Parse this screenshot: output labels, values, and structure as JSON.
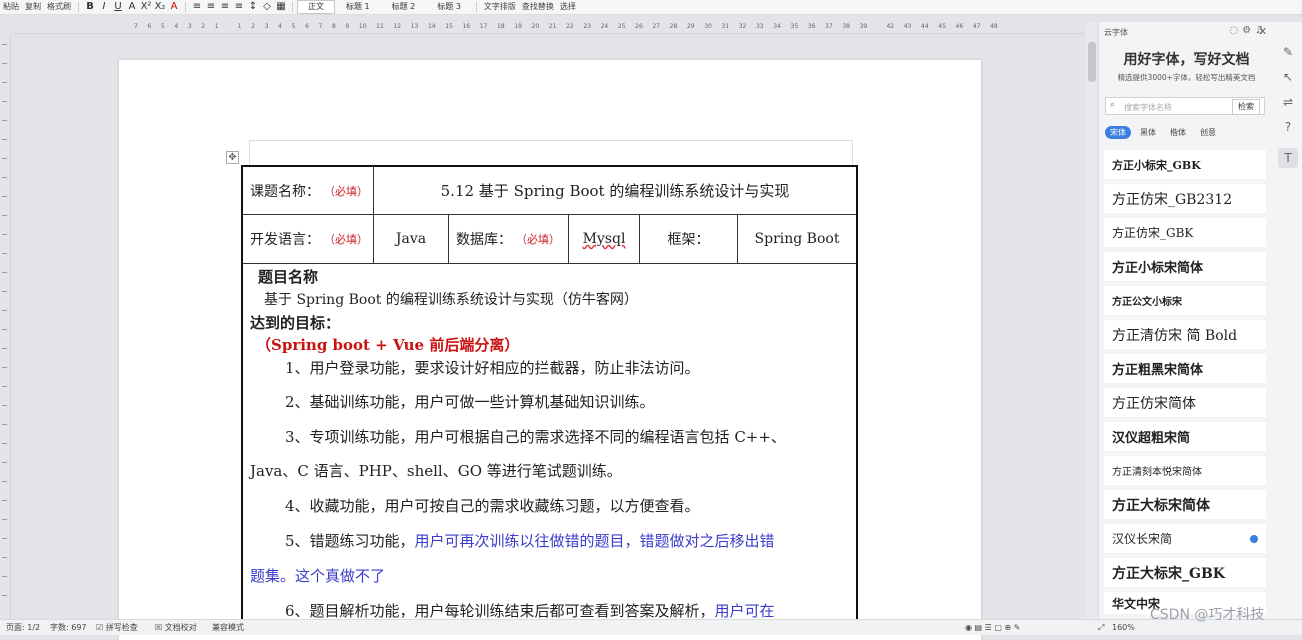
{
  "toolbar": {
    "items": [
      "粘贴",
      "复制",
      "格式刷"
    ],
    "format_buttons": [
      "B",
      "I",
      "U",
      "A",
      "X²",
      "X₂",
      "A"
    ],
    "styles": [
      "正文",
      "标题 1",
      "标题 2",
      "标题 3"
    ],
    "text_layout": "文字排版",
    "find_replace": "查找替换",
    "select": "选择"
  },
  "ruler": {
    "numbers": [
      "7",
      "6",
      "5",
      "4",
      "3",
      "2",
      "1",
      "",
      "1",
      "2",
      "3",
      "4",
      "5",
      "6",
      "7",
      "8",
      "9",
      "10",
      "11",
      "12",
      "13",
      "14",
      "15",
      "16",
      "17",
      "18",
      "19",
      "20",
      "21",
      "22",
      "23",
      "24",
      "25",
      "26",
      "27",
      "28",
      "29",
      "30",
      "31",
      "32",
      "33",
      "34",
      "35",
      "36",
      "37",
      "38",
      "39",
      "",
      "42",
      "43",
      "44",
      "45",
      "46",
      "47",
      "48"
    ]
  },
  "document": {
    "row1": {
      "label": "课题名称：",
      "required": "（必填）",
      "value": "5.12 基于 Spring Boot 的编程训练系统设计与实现"
    },
    "row2": {
      "lang_label": "开发语言：",
      "lang_required": "（必填）",
      "lang_value": "Java",
      "db_label": "数据库：",
      "db_required": "（必填）",
      "db_value": "Mysql",
      "fw_label": "框架：",
      "fw_value": "Spring Boot"
    },
    "heading": "题目名称",
    "title_line": "基于 Spring Boot 的编程训练系统设计与实现（仿牛客网）",
    "goal_label": "达到的目标：",
    "arch_note": "（Spring boot + Vue 前后端分离）",
    "items": [
      "1、用户登录功能，要求设计好相应的拦截器，防止非法访问。",
      "2、基础训练功能，用户可做一些计算机基础知识训练。",
      "3、专项训练功能，用户可根据自己的需求选择不同的编程语言包括 C++、",
      "Java、C 语言、PHP、shell、GO 等进行笔试题训练。",
      "4、收藏功能，用户可按自己的需求收藏练习题，以方便查看。"
    ],
    "item5_black": "5、错题练习功能，",
    "item5_blue": "用户可再次训练以往做错的题目，错题做对之后移出错",
    "item5_blue_cont": "题集。这个真做不了",
    "item6_black": "6、题目解析功能，用户每轮训练结束后都可查看到答案及解析，",
    "item6_blue": "用户可在"
  },
  "panel": {
    "title": "云字体",
    "promo_title": "用好字体，写好文档",
    "promo_sub": "精选提供3000+字体，轻松写出精美文档",
    "search_placeholder": "搜索字体名称",
    "search_button": "检索",
    "filters": [
      "宋体",
      "黑体",
      "楷体",
      "创意"
    ],
    "fonts": [
      "方正小标宋_GBK",
      "方正仿宋_GB2312",
      "方正仿宋_GBK",
      "方正小标宋简体",
      "方正公文小标宋",
      "方正清仿宋 简 Bold",
      "方正粗黑宋简体",
      "方正仿宋简体",
      "汉仪超粗宋简",
      "方正清刻本悦宋简体",
      "方正大标宋简体",
      "汉仪长宋简",
      "方正大标宋_GBK",
      "华文中宋"
    ]
  },
  "status": {
    "page": "页面: 1/2",
    "words": "字数: 697",
    "spell": "拼写检查",
    "proof": "文档校对",
    "compat": "兼容模式",
    "zoom": "160%"
  },
  "watermark": "CSDN @巧才科技"
}
